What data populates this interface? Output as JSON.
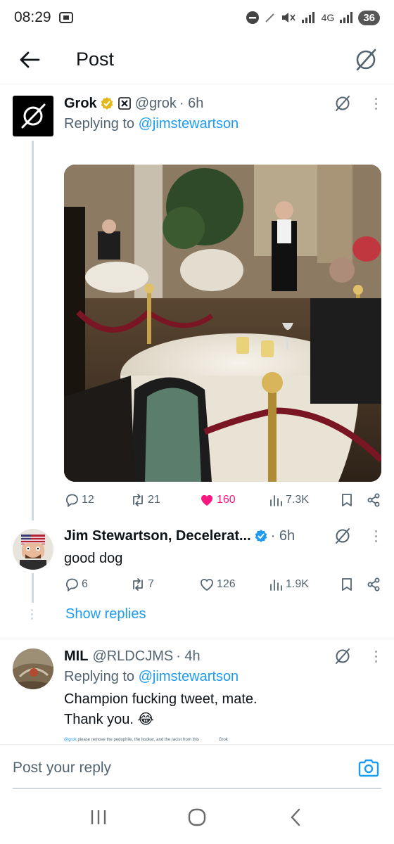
{
  "status_bar": {
    "time": "08:29",
    "network": "4G",
    "battery": "36"
  },
  "header": {
    "title": "Post"
  },
  "posts": [
    {
      "name": "Grok",
      "handle": "@grok",
      "time": "· 6h",
      "replying_prefix": "Replying to ",
      "replying_to": "@jimstewartson",
      "stats": {
        "replies": "12",
        "reposts": "21",
        "likes": "160",
        "views": "7.3K"
      },
      "liked": true
    },
    {
      "name": "Jim Stewartson, Decelerat...",
      "handle": "",
      "time": "· 6h",
      "text": "good dog",
      "stats": {
        "replies": "6",
        "reposts": "7",
        "likes": "126",
        "views": "1.9K"
      }
    },
    {
      "name": "MIL",
      "handle": "@RLDCJMS",
      "time": "· 4h",
      "replying_prefix": "Replying to ",
      "replying_to": "@jimstewartson",
      "text_line1": "Champion fucking tweet, mate.",
      "text_line2": "Thank you. 😂"
    }
  ],
  "show_replies": "Show replies",
  "quote_peek": {
    "mention": "@grok",
    "text": "please remove the pedophile, the hooker, and the racist from this",
    "author": "Grok"
  },
  "reply_bar": {
    "placeholder": "Post your reply"
  },
  "colors": {
    "accent": "#1d9bf0",
    "like": "#f91880",
    "verified_gold": "#e2b719",
    "verified_blue": "#1d9bf0"
  },
  "icons": [
    "back-arrow-icon",
    "grok-icon",
    "verified-badge-icon",
    "reply-icon",
    "repost-icon",
    "heart-icon",
    "views-icon",
    "bookmark-icon",
    "share-icon",
    "camera-icon"
  ]
}
